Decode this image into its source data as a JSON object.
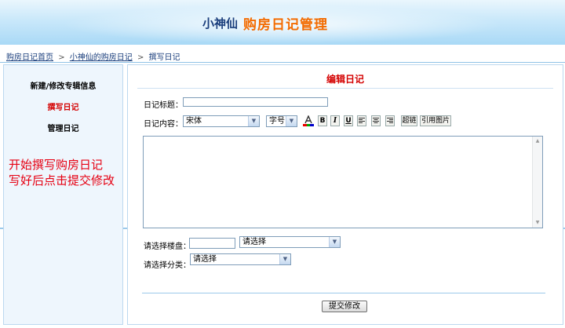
{
  "header": {
    "username": "小神仙",
    "title": "购房日记管理"
  },
  "breadcrumb": {
    "items": [
      "购房日记首页",
      "小神仙的购房日记"
    ],
    "current": "撰写日记",
    "separator": ">"
  },
  "sidebar": {
    "items": [
      {
        "label": "新建/修改专辑信息",
        "active": false
      },
      {
        "label": "撰写日记",
        "active": true
      },
      {
        "label": "管理日记",
        "active": false
      }
    ]
  },
  "annotation": {
    "line1": "开始撰写购房日记",
    "line2": "写好后点击提交修改"
  },
  "form": {
    "panel_title": "编辑日记",
    "title_label": "日记标题：",
    "title_value": "",
    "content_label": "日记内容：",
    "font_select": "宋体",
    "size_select": "字号",
    "toolbar": {
      "color_icon": "text-color-icon",
      "bold": "B",
      "italic": "I",
      "underline": "U",
      "align_left_icon": "align-left-icon",
      "align_center_icon": "align-center-icon",
      "align_right_icon": "align-right-icon",
      "link_label": "超链",
      "image_label": "引用图片"
    },
    "content_value": "",
    "building_label": "请选择楼盘：",
    "building_input": "",
    "building_select": "请选择",
    "category_label": "请选择分类：",
    "category_select": "请选择",
    "submit_label": "提交修改"
  },
  "colors": {
    "accent_red": "#d40000",
    "brand_orange": "#f36b00",
    "link_blue": "#1a3e7c",
    "annotation_red": "#e60012"
  }
}
